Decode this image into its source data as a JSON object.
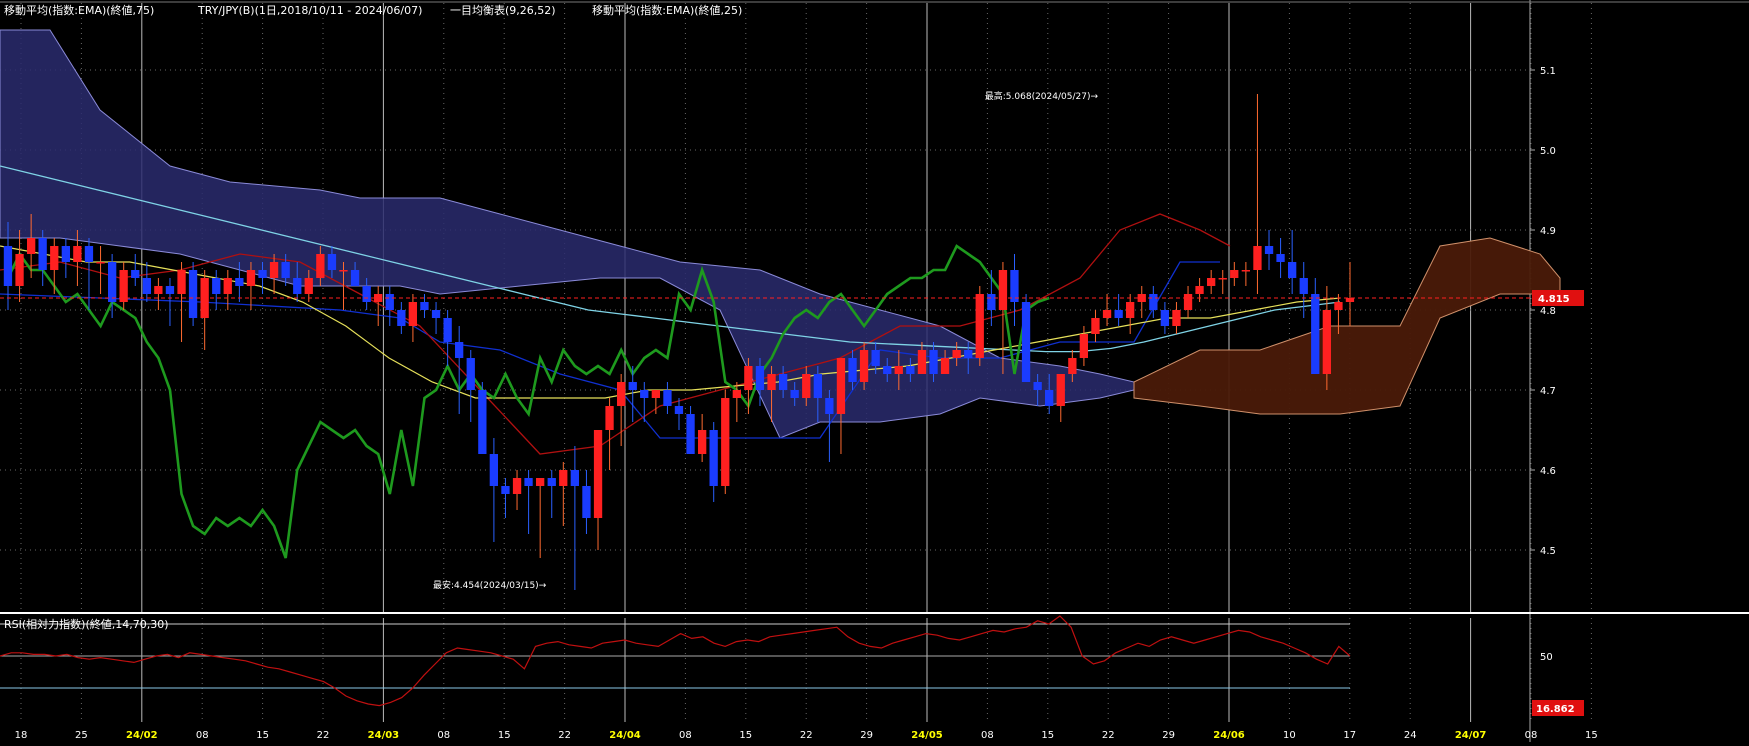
{
  "header": {
    "ema75": "移動平均(指数:EMA)(終値,75)",
    "pair": "TRY/JPY(B)(1日,2018/10/11 - 2024/06/07)",
    "ichimoku": "一目均衡表(9,26,52)",
    "ema25": "移動平均(指数:EMA)(終値,25)"
  },
  "rsi_header": "RSI(相対力指数)(終値,14,70,30)",
  "annotations": {
    "high": "最高:5.068(2024/05/27)→",
    "low": "最安:4.454(2024/03/15)→"
  },
  "price_badge": "4.815",
  "rsi_badge": "16.862",
  "colors": {
    "up": "#ff2020",
    "down": "#1a3cff",
    "ema75": "#7fd3e6",
    "ema25": "#e6e05a",
    "chikou": "#1e9a1e",
    "kijun": "#1030d0",
    "tenkan": "#b01010",
    "kumo_bear": "#2a2c6e",
    "kumo_bull": "#4a1a08",
    "rsi": "#c01010"
  },
  "chart_data": [
    {
      "type": "candlestick",
      "x_ticks": [
        "18",
        "25",
        "24/02",
        "08",
        "15",
        "22",
        "24/03",
        "08",
        "15",
        "22",
        "24/04",
        "08",
        "15",
        "22",
        "29",
        "24/05",
        "08",
        "15",
        "22",
        "29",
        "24/06",
        "10",
        "17",
        "24",
        "24/07",
        "08",
        "15"
      ],
      "y_ticks": [
        4.5,
        4.6,
        4.7,
        4.8,
        4.9,
        5.0,
        5.1
      ],
      "ylim": [
        4.43,
        5.17
      ],
      "candles": [
        [
          4.88,
          4.91,
          4.8,
          4.83
        ],
        [
          4.83,
          4.9,
          4.81,
          4.87
        ],
        [
          4.87,
          4.92,
          4.84,
          4.89
        ],
        [
          4.89,
          4.9,
          4.83,
          4.85
        ],
        [
          4.85,
          4.89,
          4.82,
          4.88
        ],
        [
          4.88,
          4.89,
          4.84,
          4.86
        ],
        [
          4.86,
          4.9,
          4.83,
          4.88
        ],
        [
          4.88,
          4.89,
          4.8,
          4.86
        ],
        [
          4.86,
          4.88,
          4.82,
          4.86
        ],
        [
          4.86,
          4.87,
          4.79,
          4.81
        ],
        [
          4.81,
          4.86,
          4.8,
          4.85
        ],
        [
          4.85,
          4.87,
          4.83,
          4.84
        ],
        [
          4.84,
          4.86,
          4.81,
          4.82
        ],
        [
          4.82,
          4.84,
          4.8,
          4.83
        ],
        [
          4.83,
          4.84,
          4.78,
          4.82
        ],
        [
          4.82,
          4.86,
          4.76,
          4.85
        ],
        [
          4.85,
          4.86,
          4.78,
          4.79
        ],
        [
          4.79,
          4.85,
          4.75,
          4.84
        ],
        [
          4.84,
          4.85,
          4.8,
          4.82
        ],
        [
          4.82,
          4.85,
          4.8,
          4.84
        ],
        [
          4.84,
          4.86,
          4.81,
          4.83
        ],
        [
          4.83,
          4.86,
          4.8,
          4.85
        ],
        [
          4.85,
          4.86,
          4.82,
          4.84
        ],
        [
          4.84,
          4.87,
          4.82,
          4.86
        ],
        [
          4.86,
          4.87,
          4.83,
          4.84
        ],
        [
          4.84,
          4.86,
          4.81,
          4.82
        ],
        [
          4.82,
          4.85,
          4.81,
          4.84
        ],
        [
          4.84,
          4.88,
          4.83,
          4.87
        ],
        [
          4.87,
          4.88,
          4.84,
          4.85
        ],
        [
          4.85,
          4.86,
          4.8,
          4.85
        ],
        [
          4.85,
          4.86,
          4.83,
          4.83
        ],
        [
          4.83,
          4.84,
          4.8,
          4.81
        ],
        [
          4.81,
          4.83,
          4.78,
          4.82
        ],
        [
          4.82,
          4.83,
          4.78,
          4.8
        ],
        [
          4.8,
          4.81,
          4.77,
          4.78
        ],
        [
          4.78,
          4.82,
          4.76,
          4.81
        ],
        [
          4.81,
          4.82,
          4.79,
          4.8
        ],
        [
          4.8,
          4.81,
          4.77,
          4.79
        ],
        [
          4.79,
          4.8,
          4.73,
          4.76
        ],
        [
          4.76,
          4.78,
          4.67,
          4.74
        ],
        [
          4.74,
          4.75,
          4.66,
          4.7
        ],
        [
          4.7,
          4.71,
          4.64,
          4.62
        ],
        [
          4.62,
          4.64,
          4.51,
          4.58
        ],
        [
          4.58,
          4.59,
          4.54,
          4.57
        ],
        [
          4.57,
          4.6,
          4.55,
          4.59
        ],
        [
          4.59,
          4.6,
          4.52,
          4.58
        ],
        [
          4.58,
          4.59,
          4.49,
          4.59
        ],
        [
          4.59,
          4.6,
          4.54,
          4.58
        ],
        [
          4.58,
          4.61,
          4.53,
          4.6
        ],
        [
          4.6,
          4.63,
          4.45,
          4.58
        ],
        [
          4.58,
          4.6,
          4.52,
          4.54
        ],
        [
          4.54,
          4.63,
          4.5,
          4.65
        ],
        [
          4.65,
          4.69,
          4.6,
          4.68
        ],
        [
          4.68,
          4.72,
          4.63,
          4.71
        ],
        [
          4.71,
          4.73,
          4.66,
          4.7
        ],
        [
          4.7,
          4.71,
          4.66,
          4.69
        ],
        [
          4.69,
          4.7,
          4.67,
          4.7
        ],
        [
          4.7,
          4.71,
          4.67,
          4.68
        ],
        [
          4.68,
          4.69,
          4.65,
          4.67
        ],
        [
          4.67,
          4.68,
          4.63,
          4.62
        ],
        [
          4.62,
          4.67,
          4.61,
          4.65
        ],
        [
          4.65,
          4.66,
          4.56,
          4.58
        ],
        [
          4.58,
          4.7,
          4.57,
          4.69
        ],
        [
          4.69,
          4.71,
          4.66,
          4.7
        ],
        [
          4.7,
          4.74,
          4.67,
          4.73
        ],
        [
          4.73,
          4.74,
          4.68,
          4.7
        ],
        [
          4.7,
          4.73,
          4.66,
          4.72
        ],
        [
          4.72,
          4.73,
          4.69,
          4.7
        ],
        [
          4.7,
          4.71,
          4.68,
          4.69
        ],
        [
          4.69,
          4.73,
          4.68,
          4.72
        ],
        [
          4.72,
          4.73,
          4.66,
          4.69
        ],
        [
          4.69,
          4.7,
          4.61,
          4.67
        ],
        [
          4.67,
          4.72,
          4.62,
          4.74
        ],
        [
          4.74,
          4.75,
          4.7,
          4.71
        ],
        [
          4.71,
          4.76,
          4.7,
          4.75
        ],
        [
          4.75,
          4.76,
          4.72,
          4.73
        ],
        [
          4.73,
          4.74,
          4.71,
          4.72
        ],
        [
          4.72,
          4.75,
          4.7,
          4.73
        ],
        [
          4.73,
          4.74,
          4.71,
          4.72
        ],
        [
          4.72,
          4.76,
          4.72,
          4.75
        ],
        [
          4.75,
          4.76,
          4.71,
          4.72
        ],
        [
          4.72,
          4.75,
          4.72,
          4.74
        ],
        [
          4.74,
          4.76,
          4.73,
          4.75
        ],
        [
          4.75,
          4.76,
          4.72,
          4.74
        ],
        [
          4.74,
          4.83,
          4.73,
          4.82
        ],
        [
          4.82,
          4.85,
          4.78,
          4.8
        ],
        [
          4.8,
          4.86,
          4.72,
          4.85
        ],
        [
          4.85,
          4.87,
          4.78,
          4.81
        ],
        [
          4.81,
          4.82,
          4.72,
          4.71
        ],
        [
          4.71,
          4.72,
          4.68,
          4.7
        ],
        [
          4.7,
          4.72,
          4.67,
          4.68
        ],
        [
          4.68,
          4.71,
          4.66,
          4.72
        ],
        [
          4.72,
          4.75,
          4.71,
          4.74
        ],
        [
          4.74,
          4.78,
          4.73,
          4.77
        ],
        [
          4.77,
          4.8,
          4.76,
          4.79
        ],
        [
          4.79,
          4.82,
          4.78,
          4.8
        ],
        [
          4.8,
          4.82,
          4.78,
          4.79
        ],
        [
          4.79,
          4.82,
          4.77,
          4.81
        ],
        [
          4.81,
          4.83,
          4.79,
          4.82
        ],
        [
          4.82,
          4.83,
          4.79,
          4.8
        ],
        [
          4.8,
          4.81,
          4.77,
          4.78
        ],
        [
          4.78,
          4.81,
          4.77,
          4.8
        ],
        [
          4.8,
          4.83,
          4.79,
          4.82
        ],
        [
          4.82,
          4.84,
          4.81,
          4.83
        ],
        [
          4.83,
          4.85,
          4.82,
          4.84
        ],
        [
          4.84,
          4.85,
          4.82,
          4.84
        ],
        [
          4.84,
          4.86,
          4.83,
          4.85
        ],
        [
          4.85,
          4.86,
          4.83,
          4.85
        ],
        [
          4.85,
          5.07,
          4.82,
          4.88
        ],
        [
          4.88,
          4.9,
          4.85,
          4.87
        ],
        [
          4.87,
          4.89,
          4.84,
          4.86
        ],
        [
          4.86,
          4.9,
          4.82,
          4.84
        ],
        [
          4.84,
          4.86,
          4.79,
          4.82
        ],
        [
          4.82,
          4.84,
          4.72,
          4.72
        ],
        [
          4.72,
          4.83,
          4.7,
          4.8
        ],
        [
          4.8,
          4.82,
          4.77,
          4.81
        ],
        [
          4.81,
          4.86,
          4.78,
          4.815
        ]
      ],
      "ema75": [
        4.98,
        4.97,
        4.96,
        4.95,
        4.94,
        4.93,
        4.92,
        4.91,
        4.9,
        4.89,
        4.88,
        4.87,
        4.86,
        4.85,
        4.84,
        4.83,
        4.82,
        4.81,
        4.8,
        4.795,
        4.79,
        4.785,
        4.78,
        4.775,
        4.77,
        4.765,
        4.76,
        4.758,
        4.756,
        4.754,
        4.752,
        4.75,
        4.748,
        4.748,
        4.752,
        4.76,
        4.77,
        4.78,
        4.79,
        4.8,
        4.805,
        4.81
      ],
      "ema25": [
        4.88,
        4.87,
        4.86,
        4.86,
        4.85,
        4.84,
        4.83,
        4.81,
        4.78,
        4.74,
        4.71,
        4.69,
        4.69,
        4.69,
        4.69,
        4.7,
        4.7,
        4.705,
        4.71,
        4.72,
        4.725,
        4.73,
        4.74,
        4.75,
        4.76,
        4.77,
        4.78,
        4.79,
        4.79,
        4.8,
        4.81,
        4.815
      ],
      "rsi": {
        "ylim": [
          0,
          100
        ],
        "y_ticks": [
          50
        ],
        "values": [
          50,
          52,
          52,
          51,
          51,
          50,
          51,
          49,
          48,
          49,
          48,
          47,
          46,
          48,
          50,
          51,
          49,
          52,
          51,
          50,
          49,
          48,
          47,
          45,
          43,
          42,
          40,
          38,
          36,
          34,
          30,
          25,
          22,
          20,
          19,
          21,
          24,
          30,
          38,
          45,
          52,
          55,
          54,
          53,
          52,
          50,
          48,
          42,
          56,
          58,
          59,
          57,
          56,
          55,
          58,
          59,
          60,
          58,
          57,
          56,
          60,
          64,
          61,
          62,
          58,
          56,
          59,
          60,
          59,
          62,
          63,
          64,
          65,
          66,
          67,
          68,
          62,
          58,
          56,
          55,
          58,
          60,
          62,
          64,
          63,
          61,
          60,
          62,
          64,
          66,
          65,
          67,
          68,
          72,
          70,
          75,
          68,
          50,
          45,
          47,
          52,
          55,
          58,
          56,
          60,
          62,
          60,
          58,
          60,
          62,
          64,
          66,
          65,
          62,
          60,
          58,
          55,
          52,
          48,
          45,
          56,
          50
        ]
      }
    }
  ]
}
